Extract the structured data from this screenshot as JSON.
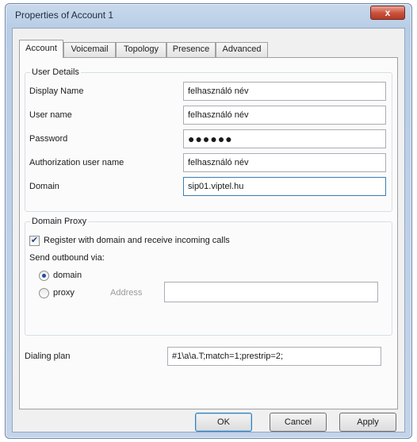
{
  "window": {
    "title": "Properties of Account 1",
    "close_label": "x"
  },
  "tabs": [
    {
      "label": "Account",
      "active": true
    },
    {
      "label": "Voicemail",
      "active": false
    },
    {
      "label": "Topology",
      "active": false
    },
    {
      "label": "Presence",
      "active": false
    },
    {
      "label": "Advanced",
      "active": false
    }
  ],
  "user_details": {
    "label": "User Details",
    "display_name": {
      "label": "Display Name",
      "value": "felhasználó név"
    },
    "user_name": {
      "label": "User name",
      "value": "felhasználó név"
    },
    "password": {
      "label": "Password",
      "value": "●●●●●●"
    },
    "auth_user_name": {
      "label": "Authorization user name",
      "value": "felhasználó név"
    },
    "domain": {
      "label": "Domain",
      "value": "sip01.viptel.hu"
    }
  },
  "domain_proxy": {
    "label": "Domain Proxy",
    "register_label": "Register with domain and receive incoming calls",
    "register_checked": true,
    "send_outbound_label": "Send outbound via:",
    "option_domain": "domain",
    "option_proxy": "proxy",
    "selected": "domain",
    "address_label": "Address",
    "address_value": ""
  },
  "dialing_plan": {
    "label": "Dialing plan",
    "value": "#1\\a\\a.T;match=1;prestrip=2;"
  },
  "buttons": {
    "ok": "OK",
    "cancel": "Cancel",
    "apply": "Apply"
  },
  "colors": {
    "title_bar": "#c3d4ea",
    "close_button": "#c9503b",
    "dialog_bg": "#f0f0f0"
  }
}
